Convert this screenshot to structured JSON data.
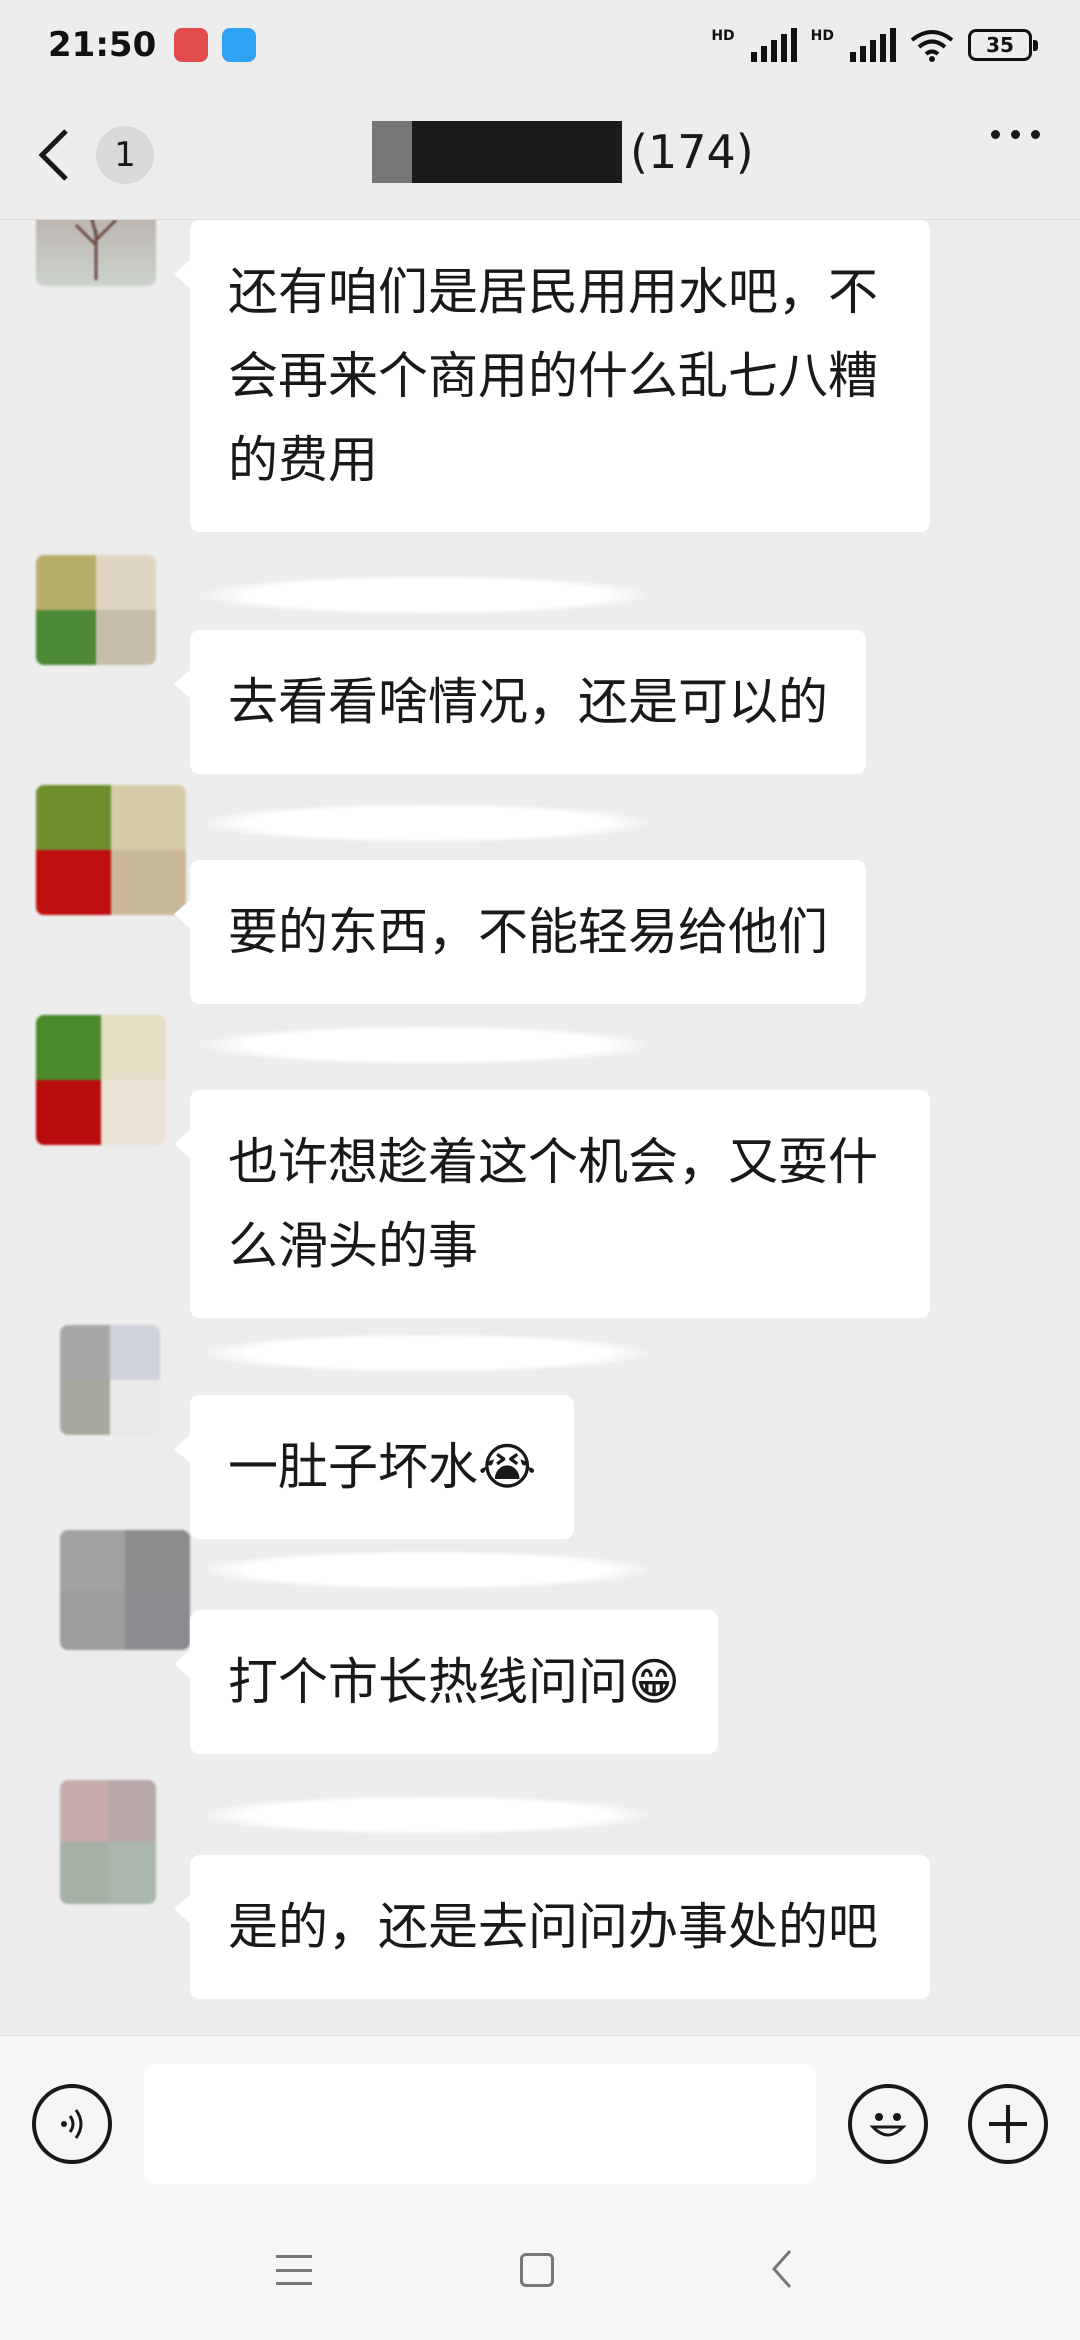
{
  "status_bar": {
    "time": "21:50",
    "hd1": "HD",
    "hd2": "HD",
    "battery": "35",
    "icons": [
      "app-notification-icon",
      "app-icon",
      "signal-icon",
      "signal-icon",
      "wifi-icon",
      "battery-icon"
    ]
  },
  "header": {
    "unread_count": "1",
    "member_count": "(174)",
    "title_redacted": true
  },
  "messages": [
    {
      "text": "还有咱们是居民用用水吧，不会再来个商用的什么乱七八糟的费用",
      "sender_redacted": false
    },
    {
      "text": "去看看啥情况，还是可以的",
      "sender_redacted": true
    },
    {
      "text": "要的东西，不能轻易给他们",
      "sender_redacted": true
    },
    {
      "text": "也许想趁着这个机会，又耍什么滑头的事",
      "sender_redacted": true
    },
    {
      "text": "一肚子坏水",
      "emoji": "😭",
      "sender_redacted": true
    },
    {
      "text": "打个市长热线问问",
      "emoji": "😁",
      "sender_redacted": true
    },
    {
      "text": "是的，还是去问问办事处的吧",
      "sender_redacted": true
    }
  ],
  "input": {
    "value": "",
    "placeholder": ""
  },
  "colors": {
    "background": "#ededed",
    "bubble": "#ffffff",
    "text": "#191919"
  }
}
